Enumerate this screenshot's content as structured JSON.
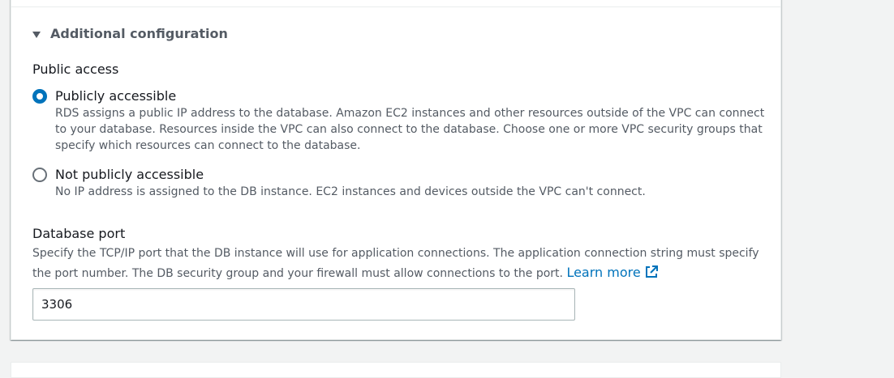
{
  "expander": {
    "label": "Additional configuration",
    "icon": "caret-down-icon"
  },
  "public_access": {
    "label": "Public access",
    "options": [
      {
        "label": "Publicly accessible",
        "description": "RDS assigns a public IP address to the database. Amazon EC2 instances and other resources outside of the VPC can connect to your database. Resources inside the VPC can also connect to the database. Choose one or more VPC security groups that specify which resources can connect to the database.",
        "selected": true
      },
      {
        "label": "Not publicly accessible",
        "description": "No IP address is assigned to the DB instance. EC2 instances and devices outside the VPC can't connect.",
        "selected": false
      }
    ]
  },
  "database_port": {
    "label": "Database port",
    "description": "Specify the TCP/IP port that the DB instance will use for application connections. The application connection string must specify the port number. The DB security group and your firewall must allow connections to the port.",
    "learn_more": "Learn more",
    "value": "3306"
  },
  "colors": {
    "accent": "#0073bb",
    "text": "#16191f",
    "secondary_text": "#545b64",
    "border": "#aab7b8",
    "background": "#f2f3f3"
  }
}
